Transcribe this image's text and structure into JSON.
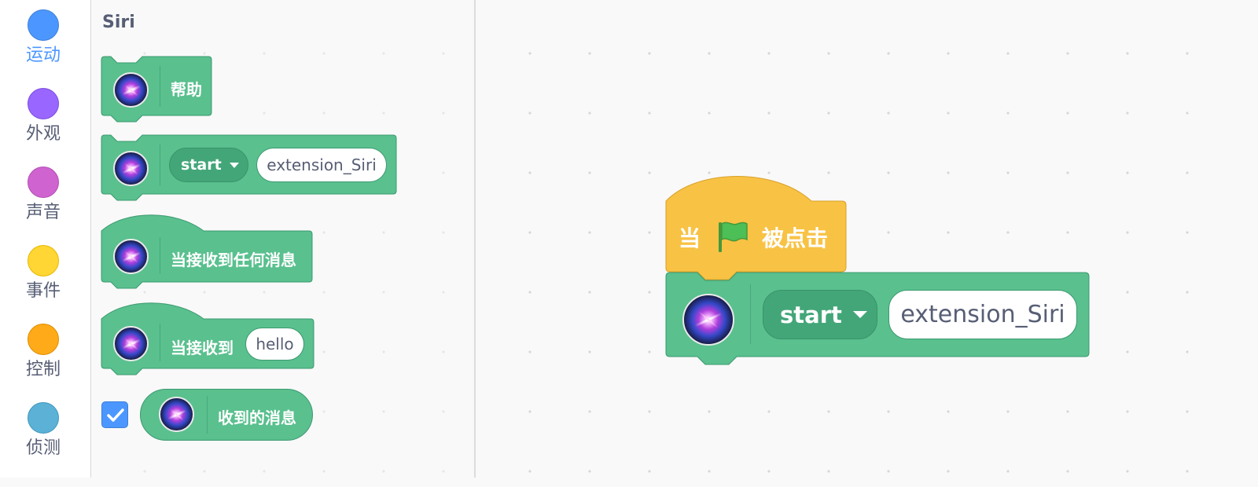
{
  "categories": [
    {
      "label": "运动",
      "color": "#4c97ff",
      "border": "#3d7fd8",
      "active": true
    },
    {
      "label": "外观",
      "color": "#9966ff",
      "border": "#7d4de0",
      "active": false
    },
    {
      "label": "声音",
      "color": "#cf63cf",
      "border": "#b44fb4",
      "active": false
    },
    {
      "label": "事件",
      "color": "#ffd633",
      "border": "#e6b800",
      "active": false
    },
    {
      "label": "控制",
      "color": "#ffab19",
      "border": "#e08c00",
      "active": false
    },
    {
      "label": "侦测",
      "color": "#5cb1d6",
      "border": "#3f97bd",
      "active": false
    }
  ],
  "flyout": {
    "title": "Siri",
    "help_block": {
      "label": "帮助",
      "icon": "siri-icon"
    },
    "start_block": {
      "dropdown": "start",
      "input": "extension_Siri",
      "icon": "siri-icon"
    },
    "any_message_hat": {
      "label": "当接收到任何消息",
      "icon": "siri-icon"
    },
    "receive_hat": {
      "label": "当接收到",
      "input": "hello",
      "icon": "siri-icon"
    },
    "message_reporter": {
      "label": "收到的消息",
      "checked": true,
      "icon": "siri-icon"
    }
  },
  "workspace": {
    "flag_hat": {
      "when": "当",
      "clicked": "被点击",
      "icon": "green-flag-icon"
    },
    "start_block": {
      "dropdown": "start",
      "input": "extension_Siri",
      "icon": "siri-icon"
    }
  },
  "colors": {
    "extension_green": "#59c08e",
    "extension_border": "#3c9a70",
    "event_yellow": "#f8c244",
    "event_border": "#d9a12a"
  }
}
